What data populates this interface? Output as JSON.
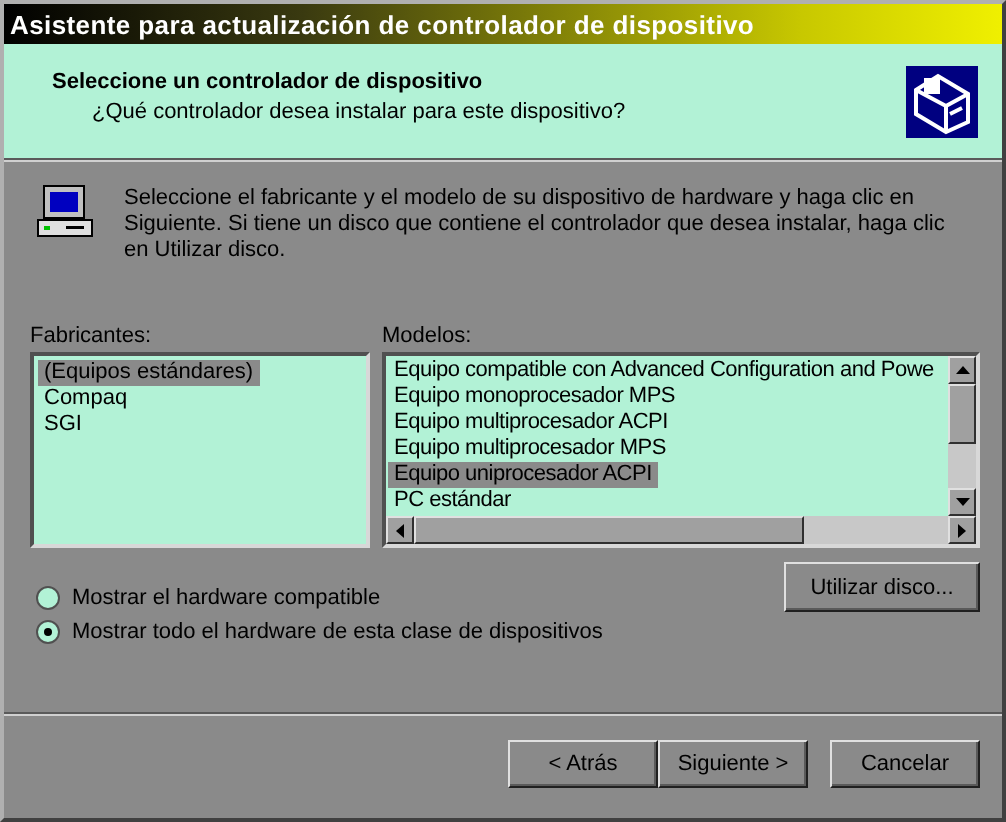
{
  "window": {
    "title": "Asistente para actualización de controlador de dispositivo"
  },
  "header": {
    "title": "Seleccione un controlador de dispositivo",
    "subtitle": "¿Qué controlador desea instalar para este dispositivo?"
  },
  "instructions": "Seleccione el fabricante y el modelo de su dispositivo de hardware y haga clic en Siguiente. Si tiene un disco que contiene el controlador que desea instalar, haga clic en Utilizar disco.",
  "manufacturers": {
    "label": "Fabricantes:",
    "items": [
      {
        "text": "(Equipos estándares)",
        "selected": true
      },
      {
        "text": "Compaq",
        "selected": false
      },
      {
        "text": "SGI",
        "selected": false
      }
    ]
  },
  "models": {
    "label": "Modelos:",
    "items": [
      {
        "text": "Equipo compatible con Advanced Configuration and Powe",
        "selected": false
      },
      {
        "text": "Equipo monoprocesador MPS",
        "selected": false
      },
      {
        "text": "Equipo multiprocesador ACPI",
        "selected": false
      },
      {
        "text": "Equipo multiprocesador MPS",
        "selected": false
      },
      {
        "text": "Equipo uniprocesador ACPI",
        "selected": true
      },
      {
        "text": "PC estándar",
        "selected": false
      }
    ]
  },
  "have_disk_button": "Utilizar disco...",
  "options": [
    {
      "label": "Mostrar el hardware compatible",
      "selected": false
    },
    {
      "label": "Mostrar todo el hardware de esta clase de dispositivos",
      "selected": true
    }
  ],
  "buttons": [
    "< Atrás",
    "Siguiente >",
    "Cancelar"
  ]
}
